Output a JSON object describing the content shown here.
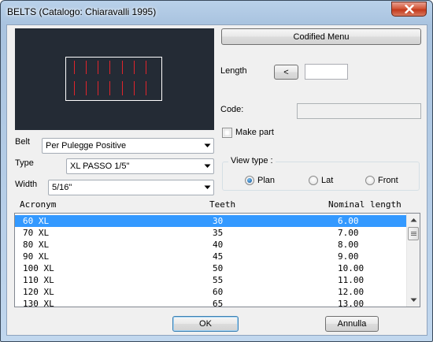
{
  "window": {
    "title": "BELTS (Catalogo: Chiaravalli 1995)"
  },
  "buttons": {
    "codified_menu": "Codified Menu",
    "less": "<",
    "ok": "OK",
    "cancel": "Annulla"
  },
  "fields": {
    "length_label": "Length",
    "length_value": "",
    "code_label": "Code:",
    "code_value": "",
    "make_part_label": "Make part"
  },
  "selects": {
    "belt_label": "Belt",
    "belt_value": "Per Pulegge Positive",
    "type_label": "Type",
    "type_value": "XL PASSO 1/5\"",
    "width_label": "Width",
    "width_value": "5/16\""
  },
  "view_type": {
    "label": "View type  :",
    "options": [
      "Plan",
      "Lat",
      "Front"
    ],
    "selected": "Plan"
  },
  "table": {
    "columns": [
      "Acronym",
      "Teeth",
      "Nominal length"
    ],
    "rows": [
      [
        "60 XL",
        "30",
        "6.00"
      ],
      [
        "70 XL",
        "35",
        "7.00"
      ],
      [
        "80 XL",
        "40",
        "8.00"
      ],
      [
        "90 XL",
        "45",
        "9.00"
      ],
      [
        "100 XL",
        "50",
        "10.00"
      ],
      [
        "110 XL",
        "55",
        "11.00"
      ],
      [
        "120 XL",
        "60",
        "12.00"
      ],
      [
        "130 XL",
        "65",
        "13.00"
      ]
    ],
    "selected_row": 0
  },
  "colors": {
    "preview_bg": "#242b35",
    "preview_outline": "#ffffff",
    "preview_lines": "#e0242c",
    "selection": "#3399ff"
  }
}
